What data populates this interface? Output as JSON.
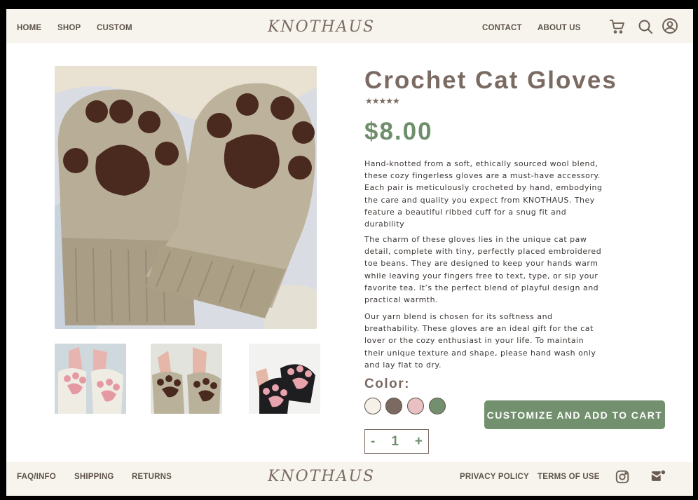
{
  "header": {
    "nav_left": [
      "HOME",
      "SHOP",
      "CUSTOM"
    ],
    "logo": "KNOTHAUS",
    "nav_right": [
      "CONTACT",
      "ABOUT US"
    ],
    "icons": [
      "cart-icon",
      "search-icon",
      "account-icon"
    ]
  },
  "product": {
    "title": "Crochet Cat Gloves",
    "rating_stars": "★★★★★",
    "price": "$8.00",
    "description": [
      "Hand-knotted from a soft, ethically sourced wool blend, these cozy fingerless gloves are a must-have accessory. Each pair is meticulously crocheted by hand, embodying the care and quality you expect from KNOTHAUS. They feature a beautiful ribbed cuff for a snug fit and durability",
      "The charm of these gloves lies in the unique cat paw detail, complete with tiny, perfectly placed embroidered toe beans. They are designed to keep your hands warm while leaving your fingers free to text, type, or sip your favorite tea. It’s the perfect blend of playful design and practical warmth.",
      "Our yarn blend is chosen for its softness and breathability. These gloves are an ideal gift for the cat lover or the cozy enthusiast in your life. To maintain their unique texture and shape, please hand wash only and lay flat to dry."
    ],
    "color_label": "Color:",
    "colors": [
      "#f5f1e8",
      "#7a6a62",
      "#e9c1c3",
      "#73906e"
    ],
    "quantity": {
      "minus": "-",
      "value": "1",
      "plus": "+"
    },
    "cta_label": "CUSTOMIZE AND ADD TO CART"
  },
  "footer": {
    "links_left": [
      "FAQ/INFO",
      "SHIPPING",
      "RETURNS"
    ],
    "logo": "KNOTHAUS",
    "links_right": [
      "PRIVACY POLICY",
      "TERMS OF USE"
    ],
    "icons": [
      "instagram-icon",
      "mail-icon"
    ]
  }
}
